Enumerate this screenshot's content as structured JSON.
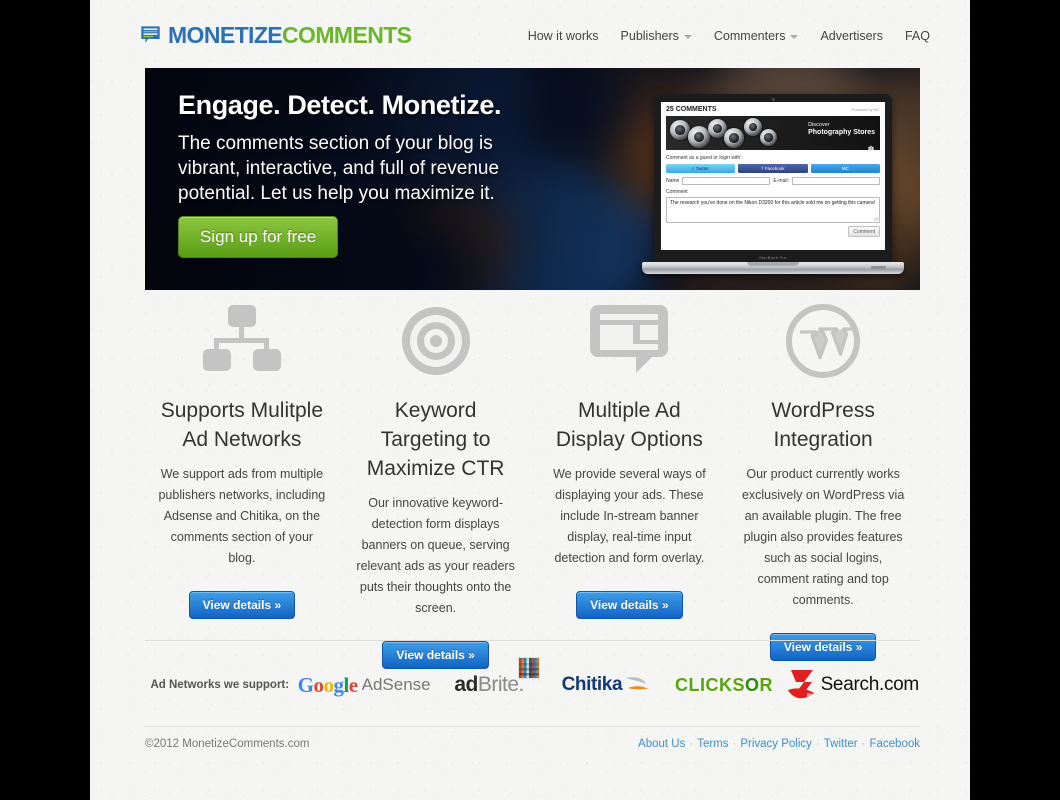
{
  "brand": {
    "name_part1": "MONETIZE",
    "name_part2": "COMMENTS",
    "icon": "speech-bubble-lines-icon",
    "color_blue": "#2a71b8",
    "color_green": "#6cb52d"
  },
  "nav": {
    "items": [
      {
        "label": "How it works",
        "has_dropdown": false
      },
      {
        "label": "Publishers",
        "has_dropdown": true
      },
      {
        "label": "Commenters",
        "has_dropdown": true
      },
      {
        "label": "Advertisers",
        "has_dropdown": false
      },
      {
        "label": "FAQ",
        "has_dropdown": false
      }
    ]
  },
  "hero": {
    "title": "Engage. Detect. Monetize.",
    "subtitle": "The comments section of your blog is vibrant, interactive, and full of revenue potential. Let us help you maximize it.",
    "cta_label": "Sign up for free",
    "cta_color": "#6fae2a"
  },
  "widget": {
    "comment_count": "25 COMMENTS",
    "powered_by": "Powered by MC",
    "ad_line1": "Discover",
    "ad_line2": "Photography Stores",
    "guest_prompt": "Comment as a guest or login with:",
    "social": [
      {
        "label": "Twitter",
        "icon": "twitter-icon"
      },
      {
        "label": "Facebook",
        "icon": "facebook-icon"
      },
      {
        "label": "MC",
        "icon": "mc-icon"
      }
    ],
    "name_label": "Name",
    "email_label": "E-mail:",
    "comment_label": "Comment",
    "comment_text": "The research you've done on the Nikon D3200 for this article sold me on getting this camera!",
    "submit_label": "Comment",
    "device_label": "MacBook Pro"
  },
  "features": [
    {
      "icon": "network-sitemap-icon",
      "title": "Supports Mulitple Ad Networks",
      "desc": "We support ads from multiple publishers networks, including Adsense and Chitika, on the comments section of your blog.",
      "button": "View details »"
    },
    {
      "icon": "target-bullseye-icon",
      "title": "Keyword Targeting to Maximize CTR",
      "desc": "Our innovative keyword-detection form displays banners on queue, serving relevant ads as your readers puts their thoughts onto the screen.",
      "button": "View details »"
    },
    {
      "icon": "speech-bubble-icon",
      "title": "Multiple Ad Display Options",
      "desc": "We provide several ways of displaying your ads. These include In-stream banner display, real-time input detection and form overlay.",
      "button": "View details »"
    },
    {
      "icon": "wordpress-icon",
      "title": "WordPress Integration",
      "desc": "Our product currently works exclusively on WordPress via an available plugin. The free plugin also provides features such as social logins, comment rating and top comments.",
      "button": "View details »"
    }
  ],
  "partners": {
    "label": "Ad Networks we support:",
    "logos": [
      {
        "name": "Google AdSense",
        "text": "AdSense",
        "brand": "Google"
      },
      {
        "name": "adBrite",
        "text": "adBrite."
      },
      {
        "name": "Chitika",
        "text": "Chitika"
      },
      {
        "name": "Clicksor",
        "text": "CLICKSOR"
      },
      {
        "name": "7Search.com",
        "text": "Search.com"
      }
    ]
  },
  "footer": {
    "copyright": "©2012 MonetizeComments.com",
    "links": [
      "About Us",
      "Terms",
      "Privacy Policy",
      "Twitter",
      "Facebook"
    ],
    "separator": "·"
  }
}
